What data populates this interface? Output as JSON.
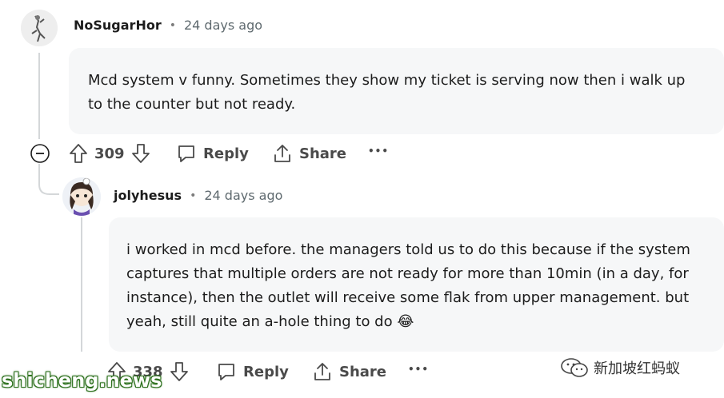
{
  "comments": [
    {
      "username": "NoSugarHor",
      "separator": "•",
      "time": "24 days ago",
      "body_lines": [
        "Mcd system v funny. Sometimes they show my ticket is serving now then i walk up",
        "to the counter but not ready."
      ],
      "votes": "309",
      "reply_label": "Reply",
      "share_label": "Share",
      "more_label": "•••"
    },
    {
      "username": "jolyhesus",
      "separator": "•",
      "time": "24 days ago",
      "body_lines": [
        "i worked in mcd before. the managers told us to do this because if the system",
        "captures that multiple orders are not ready for more than 10min (in a day, for",
        "instance), then the outlet will receive some flak from upper management. but",
        "yeah, still quite an a-hole thing to do 😂"
      ],
      "votes": "338",
      "reply_label": "Reply",
      "share_label": "Share",
      "more_label": "•••"
    }
  ],
  "watermark": "shicheng.news",
  "wechat_label": "新加坡红蚂蚁",
  "icons": {
    "collapse": "collapse-minus-icon",
    "upvote": "upvote-arrow-icon",
    "downvote": "downvote-arrow-icon",
    "reply": "speech-bubble-icon",
    "share": "share-upload-icon",
    "more": "ellipsis-icon"
  }
}
